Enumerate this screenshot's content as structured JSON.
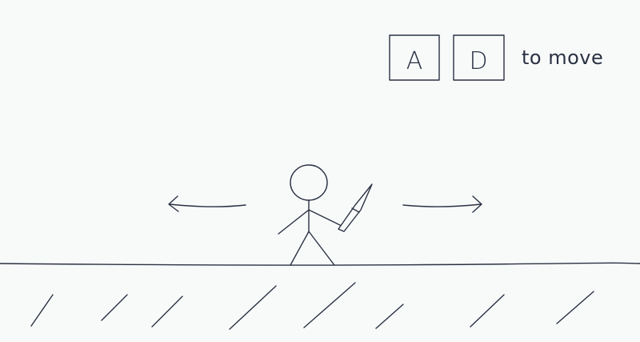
{
  "controls": {
    "left_key": "A",
    "right_key": "D",
    "hint": "to move"
  },
  "colors": {
    "ink": "#2a3142",
    "background": "#f8fafa"
  },
  "icons": {
    "player": "stick-figure-with-sword",
    "left": "arrow-left-icon",
    "right": "arrow-right-icon"
  }
}
